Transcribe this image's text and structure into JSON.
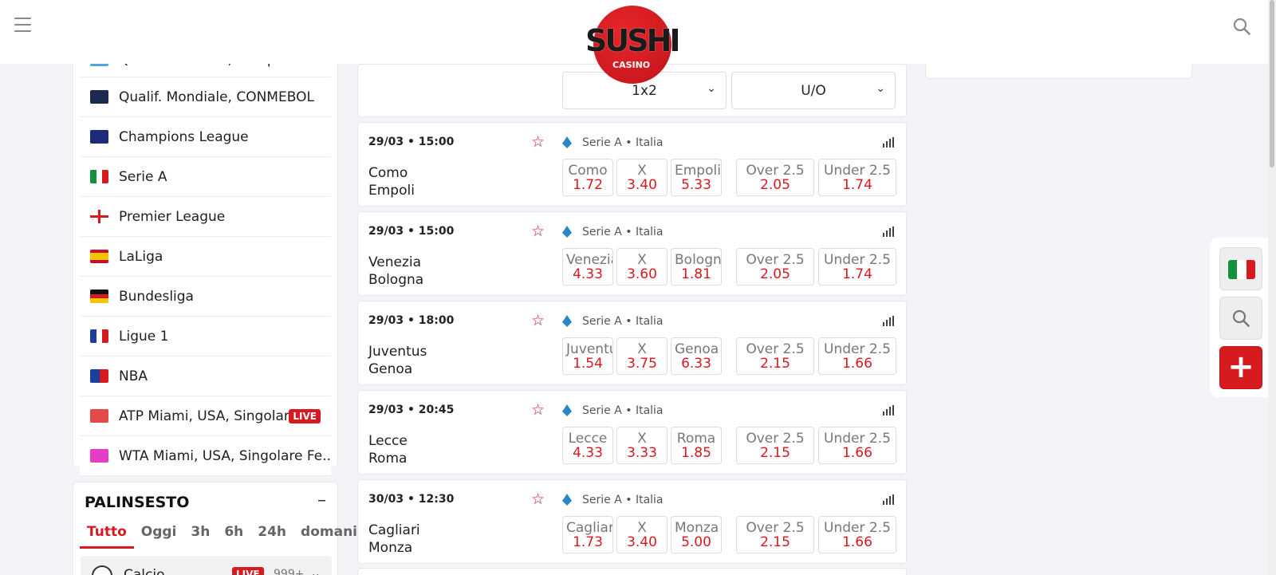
{
  "header": {
    "logo_text": "SUSHI",
    "logo_subtext": "CASINO"
  },
  "leagues": [
    {
      "name": "Qualif. Mondiale, Europa",
      "flag": "world-cup-icon",
      "live": ""
    },
    {
      "name": "Qualif. Mondiale, CONMEBOL",
      "flag": "conmebol-icon",
      "live": ""
    },
    {
      "name": "Champions League",
      "flag": "champions-league-icon",
      "live": ""
    },
    {
      "name": "Serie A",
      "flag": "italy-flag",
      "live": ""
    },
    {
      "name": "Premier League",
      "flag": "england-flag",
      "live": ""
    },
    {
      "name": "LaLiga",
      "flag": "spain-flag",
      "live": ""
    },
    {
      "name": "Bundesliga",
      "flag": "germany-flag",
      "live": ""
    },
    {
      "name": "Ligue 1",
      "flag": "france-flag",
      "live": ""
    },
    {
      "name": "NBA",
      "flag": "nba-icon",
      "live": ""
    },
    {
      "name": "ATP Miami, USA, Singolar...",
      "flag": "atp-icon",
      "live": "LIVE"
    },
    {
      "name": "WTA Miami, USA, Singolare Fe...",
      "flag": "wta-icon",
      "live": ""
    }
  ],
  "palinsesto": {
    "title": "PALINSESTO",
    "collapse_label": "–",
    "tabs": [
      "Tutto",
      "Oggi",
      "3h",
      "6h",
      "24h",
      "domani"
    ],
    "active_tab": "Tutto",
    "row": {
      "label": "Calcio",
      "live": "LIVE",
      "count": "999+"
    }
  },
  "markets": {
    "primary": "1x2",
    "secondary": "U/O"
  },
  "events": [
    {
      "datetime": "29/03 • 15:00",
      "league": "Serie A • Italia",
      "home": "Como",
      "away": "Empoli",
      "odds": [
        {
          "label": "Como",
          "value": "1.72"
        },
        {
          "label": "X",
          "value": "3.40"
        },
        {
          "label": "Empoli",
          "value": "5.33"
        }
      ],
      "ou": [
        {
          "label": "Over 2.5",
          "value": "2.05"
        },
        {
          "label": "Under 2.5",
          "value": "1.74"
        }
      ]
    },
    {
      "datetime": "29/03 • 15:00",
      "league": "Serie A • Italia",
      "home": "Venezia",
      "away": "Bologna",
      "odds": [
        {
          "label": "Venezia",
          "value": "4.33"
        },
        {
          "label": "X",
          "value": "3.60"
        },
        {
          "label": "Bologna",
          "value": "1.81"
        }
      ],
      "ou": [
        {
          "label": "Over 2.5",
          "value": "2.05"
        },
        {
          "label": "Under 2.5",
          "value": "1.74"
        }
      ]
    },
    {
      "datetime": "29/03 • 18:00",
      "league": "Serie A • Italia",
      "home": "Juventus",
      "away": "Genoa",
      "odds": [
        {
          "label": "Juventus",
          "value": "1.54"
        },
        {
          "label": "X",
          "value": "3.75"
        },
        {
          "label": "Genoa",
          "value": "6.33"
        }
      ],
      "ou": [
        {
          "label": "Over 2.5",
          "value": "2.15"
        },
        {
          "label": "Under 2.5",
          "value": "1.66"
        }
      ]
    },
    {
      "datetime": "29/03 • 20:45",
      "league": "Serie A • Italia",
      "home": "Lecce",
      "away": "Roma",
      "odds": [
        {
          "label": "Lecce",
          "value": "4.33"
        },
        {
          "label": "X",
          "value": "3.33"
        },
        {
          "label": "Roma",
          "value": "1.85"
        }
      ],
      "ou": [
        {
          "label": "Over 2.5",
          "value": "2.15"
        },
        {
          "label": "Under 2.5",
          "value": "1.66"
        }
      ]
    },
    {
      "datetime": "30/03 • 12:30",
      "league": "Serie A • Italia",
      "home": "Cagliari",
      "away": "Monza",
      "odds": [
        {
          "label": "Cagliari",
          "value": "1.73"
        },
        {
          "label": "X",
          "value": "3.40"
        },
        {
          "label": "Monza",
          "value": "5.00"
        }
      ],
      "ou": [
        {
          "label": "Over 2.5",
          "value": "2.15"
        },
        {
          "label": "Under 2.5",
          "value": "1.66"
        }
      ]
    }
  ],
  "side_widget": {
    "plus_label": "+"
  },
  "colors": {
    "accent": "#d71920",
    "background": "#f3f4f8"
  }
}
